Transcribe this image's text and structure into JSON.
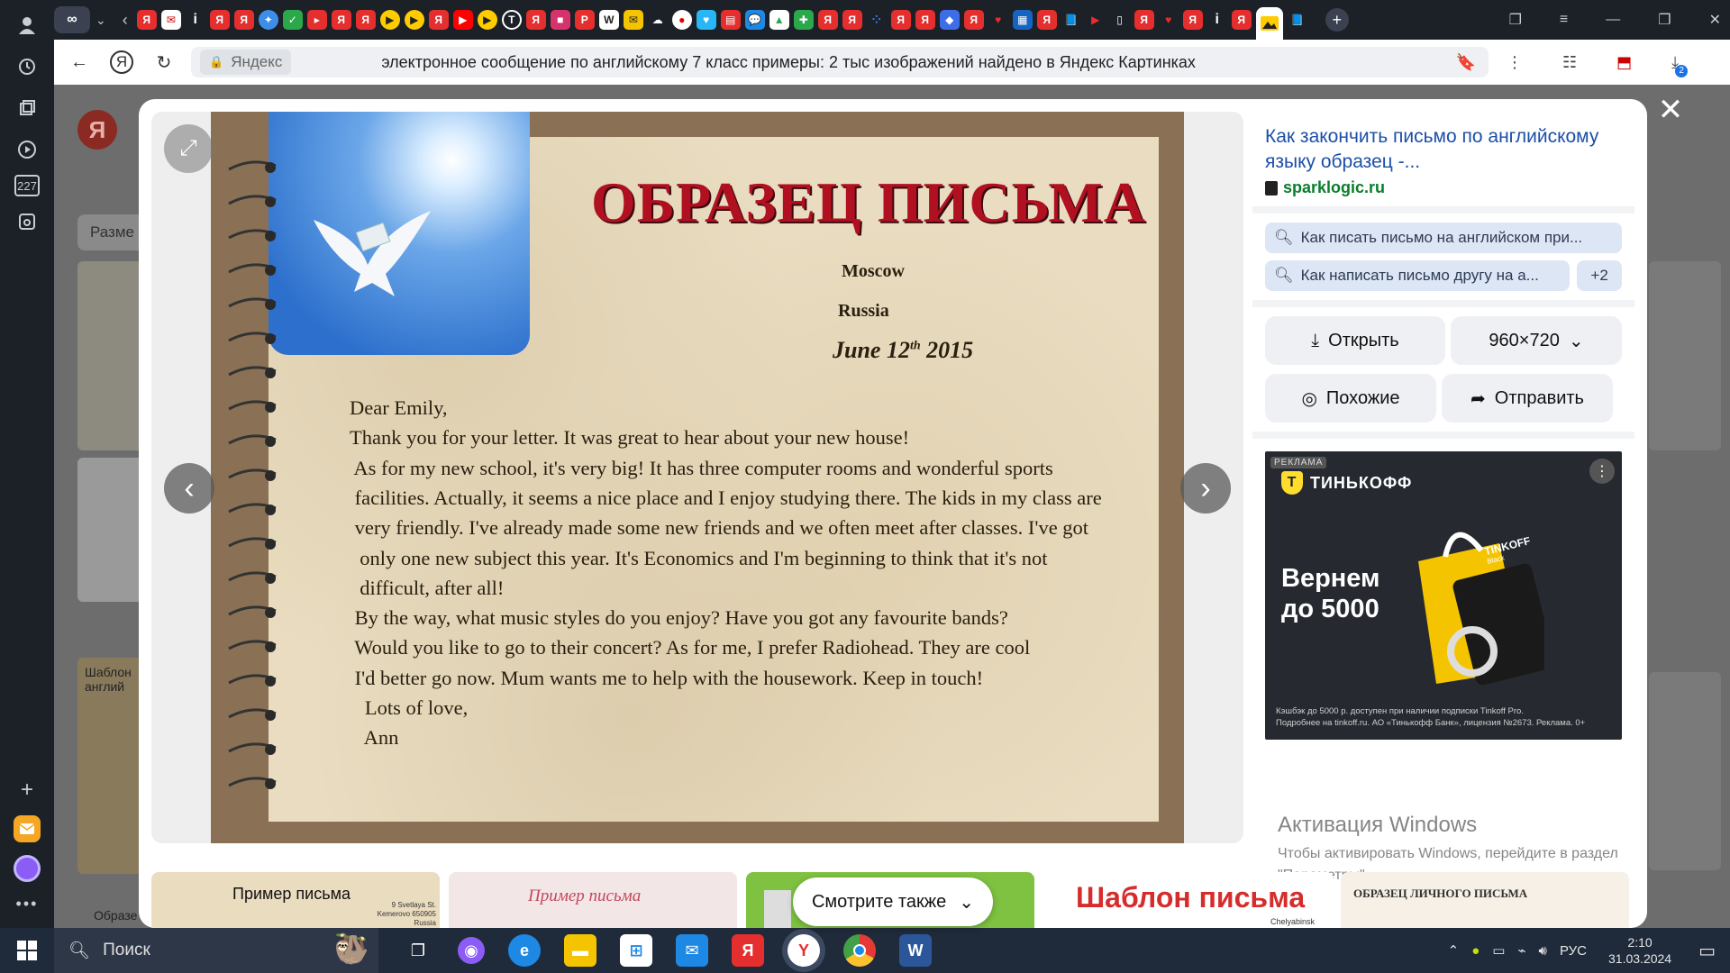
{
  "browser": {
    "address_domain": "Яндекс",
    "page_title": "электронное сообщение по английскому 7 класс примеры: 2 тыс изображений найдено в Яндекс Картинках",
    "sidebar_badge": "227",
    "download_badge": "2"
  },
  "background": {
    "logo": "Я",
    "tab_label": "Разме",
    "card1_label": "Шаблон англий",
    "card2_label": "Образе"
  },
  "viewer": {
    "letter": {
      "title": "ОБРАЗЕЦ ПИСЬМА",
      "city": "Moscow",
      "country": "Russia",
      "date_prefix": "June 12",
      "date_suffix": "th",
      "date_year": " 2015",
      "lines": [
        "Dear Emily,",
        "Thank you for your letter. It was great to hear about your new house!",
        " As for my new school, it's very big! It has three computer rooms and wonderful sports",
        " facilities. Actually, it seems a nice place and I enjoy studying there. The kids in my class are",
        " very friendly. I've already made some new friends and we often meet after classes. I've got",
        "  only one new subject this year. It's Economics and I'm beginning to think that it's not",
        "  difficult, after all!",
        " By the way, what music styles do you enjoy? Have you got any favourite bands?",
        " Would you like to go to their concert? As for me, I prefer Radiohead. They are cool",
        " I'd better go now. Mum wants me to help with the housework. Keep in touch!",
        "   Lots of love,",
        "   Ann"
      ]
    }
  },
  "panel": {
    "source_title": "Как закончить письмо по английскому языку образец -...",
    "source_site": "sparklogic.ru",
    "chip1": "Как писать письмо на английском при...",
    "chip2": "Как написать письмо другу на а...",
    "chip_more": "+2",
    "open_label": "Открыть",
    "size_label": "960×720",
    "similar_label": "Похожие",
    "share_label": "Отправить",
    "ad": {
      "label": "РЕКЛАМА",
      "brand": "ТИНЬКОФФ",
      "headline_1": "Вернем",
      "headline_2": "до 5000",
      "card_brand": "TINKOFF",
      "card_sub": "Black",
      "fine_1": "Кэшбэк до 5000 р. доступен при наличии подписки Tinkoff Pro.",
      "fine_2": "Подробнее на tinkoff.ru. АО «Тинькофф Банк», лицензия №2673. Реклама. 0+"
    }
  },
  "activation": {
    "title": "Активация Windows",
    "text": "Чтобы активировать Windows, перейдите в раздел \"Параметры\"."
  },
  "thumbs": {
    "t1_title": "Пример письма",
    "t1_addr": "9 Svetlaya St. Kemerovo 650905 Russia",
    "t2_title": "Пример письма",
    "t4_title": "Шаблон письма",
    "t4_sub": "Chelyabinsk",
    "t5_title": "ОБРАЗЕЦ ЛИЧНОГО ПИСЬМА",
    "see_also": "Смотрите также"
  },
  "taskbar": {
    "search_label": "Поиск",
    "lang": "РУС",
    "time": "2:10",
    "date": "31.03.2024"
  },
  "colors": {
    "link_blue": "#1a4fa8",
    "site_green": "#0a7d2c",
    "letter_title_red": "#b01020",
    "tinkoff_yellow": "#ffdd2d"
  }
}
